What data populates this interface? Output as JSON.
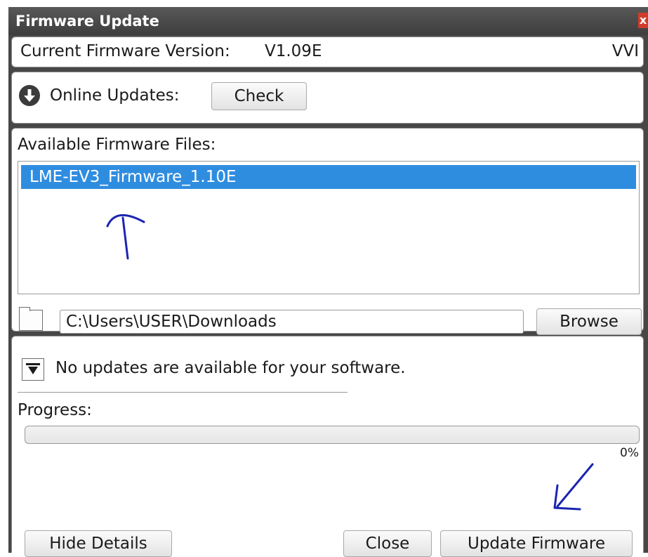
{
  "dialog": {
    "title": "Firmware Update",
    "close_glyph": "x"
  },
  "current_version": {
    "label": "Current Firmware Version:",
    "value": "V1.09E",
    "suffix": "VVI"
  },
  "online_updates": {
    "icon": "download-arrow-icon",
    "label": "Online Updates:",
    "check_label": "Check"
  },
  "files": {
    "heading": "Available Firmware Files:",
    "items": [
      "LME-EV3_Firmware_1.10E"
    ],
    "selected_index": 0,
    "folder_icon": "folder-icon",
    "path": "C:\\Users\\USER\\Downloads",
    "browse_label": "Browse"
  },
  "details": {
    "expand_icon": "expand-toggle-icon",
    "status": "No updates are available for your software.",
    "progress_label": "Progress:",
    "progress_value": 0,
    "progress_text": "0%"
  },
  "footer": {
    "hide_details_label": "Hide Details",
    "close_label": "Close",
    "update_label": "Update Firmware"
  },
  "colors": {
    "titlebar": "#474747",
    "selection": "#2f8de0",
    "annotation_ink": "#1c25b0",
    "close_red": "#d23c2c"
  }
}
